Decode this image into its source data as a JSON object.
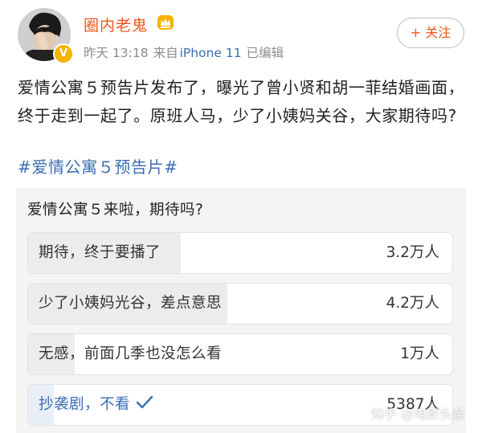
{
  "header": {
    "username": "圈内老鬼",
    "time": "昨天 13:18",
    "source_prefix": "来自",
    "source": "iPhone 11",
    "edited": "已编辑",
    "verified_glyph": "V",
    "follow_label": "+ 关注"
  },
  "post": {
    "text": "爱情公寓５预告片发布了，曝光了曾小贤和胡一菲结婚画面，终于走到一起了。原班人马，少了小姨妈关谷，大家期待吗?",
    "hashtag": "#爱情公寓５预告片#"
  },
  "poll": {
    "question": "爱情公寓５来啦，期待吗?",
    "options": [
      {
        "label": "期待，终于要播了",
        "count": "3.2万人",
        "share": 0.36,
        "voted": false
      },
      {
        "label": "少了小姨妈光谷，差点意思",
        "count": "4.2万人",
        "share": 0.47,
        "voted": false
      },
      {
        "label": "无感，前面几季也没怎么看",
        "count": "1万人",
        "share": 0.11,
        "voted": false
      },
      {
        "label": "抄袭剧，不看",
        "count": "5387人",
        "share": 0.06,
        "voted": true
      }
    ]
  },
  "watermark": "知乎 @电影头条",
  "icons": {
    "avatar": "avatar-photo",
    "verified": "verified-badge-icon",
    "crown": "crown-icon",
    "voted": "checkmark-icon"
  },
  "colors": {
    "accent": "#f2551a",
    "link": "#3a6db5",
    "poll_bg": "#f4f4f4",
    "verified": "#f6b300"
  }
}
